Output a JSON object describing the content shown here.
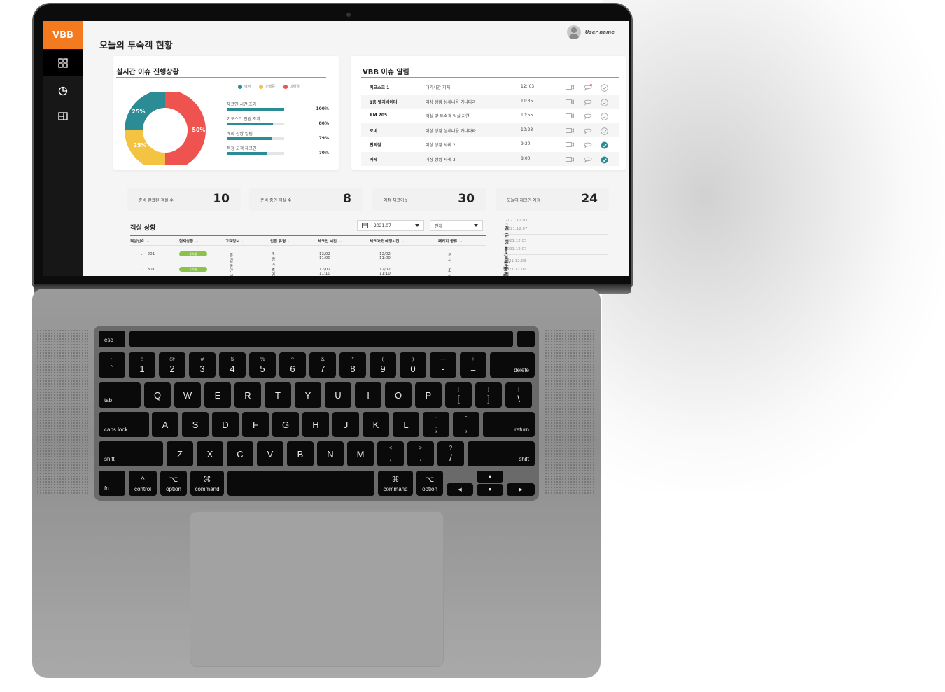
{
  "app": {
    "logo": "VBB",
    "page_title": "오늘의 투숙객 현황",
    "user_name": "User name",
    "sidebar": [
      {
        "icon": "grid-icon"
      },
      {
        "icon": "pie-chart-icon"
      },
      {
        "icon": "room-layout-icon"
      }
    ]
  },
  "progress_card": {
    "title": "실시간 이슈 진행상황",
    "legend": [
      {
        "label": "예정",
        "color": "#2b8c96"
      },
      {
        "label": "진행중",
        "color": "#f5c342"
      },
      {
        "label": "미해결",
        "color": "#ef5350"
      }
    ],
    "donut": [
      {
        "label": "50%",
        "value": 50,
        "color": "#ef5350"
      },
      {
        "label": "25%",
        "value": 25,
        "color": "#f5c342"
      },
      {
        "label": "25%",
        "value": 25,
        "color": "#2b8c96"
      }
    ],
    "bars": [
      {
        "label": "체크인 시간 초과",
        "pct": "100%",
        "value": 1.0
      },
      {
        "label": "키오스크 인원 초과",
        "pct": "80%",
        "value": 0.8
      },
      {
        "label": "배회 상황 알림",
        "pct": "79%",
        "value": 0.79
      },
      {
        "label": "특정 고객 체크인",
        "pct": "70%",
        "value": 0.7
      }
    ]
  },
  "alert_card": {
    "title": "VBB 이슈 알림",
    "rows": [
      {
        "location": "키오스크 1",
        "desc": "대기시간 지체",
        "time": "12: 03",
        "resolved": false,
        "new_message": true
      },
      {
        "location": "1층 엘리베이터",
        "desc": "이상 상황 상세내용 가나다라",
        "time": "11:35",
        "resolved": false,
        "new_message": false
      },
      {
        "location": "RM 205",
        "desc": "객실 앞 투숙객 입실 지연",
        "time": "10:55",
        "resolved": false,
        "new_message": false
      },
      {
        "location": "로비",
        "desc": "이상 상황 상세내용 가나다라",
        "time": "10:23",
        "resolved": false,
        "new_message": false
      },
      {
        "location": "편의점",
        "desc": "이상 상황 사례 2",
        "time": "9:20",
        "resolved": true,
        "new_message": false
      },
      {
        "location": "카페",
        "desc": "이상 상황 사례 3",
        "time": "8:00",
        "resolved": true,
        "new_message": false
      }
    ]
  },
  "stats": [
    {
      "label": "준비 완료된 객실 수",
      "value": "10"
    },
    {
      "label": "준비 중인 객실 수",
      "value": "8"
    },
    {
      "label": "예정 체크아웃",
      "value": "30"
    },
    {
      "label": "오늘의 체크인 예정",
      "value": "24"
    }
  ],
  "room_status": {
    "title": "객실 상황",
    "date_filter": "2021.07",
    "type_filter": "전체",
    "columns": [
      "객실번호",
      "현재상황",
      "고객정보",
      "인원 유형",
      "체크인 시간",
      "체크아웃 예정시간",
      "패키지 종류"
    ],
    "rows": [
      {
        "room": "201",
        "status": "투숙중",
        "guest": "홍길동",
        "people": "4명 가족",
        "checkin": "12/02  11:00",
        "checkout": "12/02  11:00",
        "package": "조식"
      },
      {
        "room": "301",
        "status": "투숙중",
        "guest": "안혜진",
        "people": "2명 연인",
        "checkin": "12/02  11:10",
        "checkout": "12/02  11:10",
        "package": "조식"
      }
    ]
  },
  "checkin_list": [
    {
      "dates": "2021.12.03 ~ 2021.12.07",
      "name": "김춘영 + 3인, 조식 패키지"
    },
    {
      "dates": "2021.12.03 ~ 2021.12.07",
      "name": "홍길동 + 2인, 허니문패키지"
    },
    {
      "dates": "2021.12.03 ~ 2021.12.07",
      "name": "정민수 + 2인, 상패연"
    }
  ],
  "keyboard": {
    "esc": "esc",
    "number_row": [
      {
        "top": "~",
        "main": "`"
      },
      {
        "top": "!",
        "main": "1"
      },
      {
        "top": "@",
        "main": "2"
      },
      {
        "top": "#",
        "main": "3"
      },
      {
        "top": "$",
        "main": "4"
      },
      {
        "top": "%",
        "main": "5"
      },
      {
        "top": "^",
        "main": "6"
      },
      {
        "top": "&",
        "main": "7"
      },
      {
        "top": "*",
        "main": "8"
      },
      {
        "top": "(",
        "main": "9"
      },
      {
        "top": ")",
        "main": "0"
      },
      {
        "top": "—",
        "main": "-"
      },
      {
        "top": "+",
        "main": "="
      }
    ],
    "delete": "delete",
    "tab": "tab",
    "qwerty_row": [
      "Q",
      "W",
      "E",
      "R",
      "T",
      "Y",
      "U",
      "I",
      "O",
      "P"
    ],
    "qwerty_tail": [
      {
        "top": "{",
        "main": "["
      },
      {
        "top": "}",
        "main": "]"
      },
      {
        "top": "|",
        "main": "\\"
      }
    ],
    "caps": "caps lock",
    "home_row": [
      "A",
      "S",
      "D",
      "F",
      "G",
      "H",
      "J",
      "K",
      "L"
    ],
    "home_tail": [
      {
        "top": ":",
        "main": ";"
      },
      {
        "top": "\"",
        "main": ","
      }
    ],
    "return": "return",
    "shift": "shift",
    "bottom_row": [
      "Z",
      "X",
      "C",
      "V",
      "B",
      "N",
      "M"
    ],
    "bottom_tail": [
      {
        "top": "<",
        "main": ","
      },
      {
        "top": ">",
        "main": "."
      },
      {
        "top": "?",
        "main": "/"
      }
    ],
    "fn": "fn",
    "control": {
      "top": "^",
      "main": "control"
    },
    "option": {
      "top": "⌥",
      "main": "option"
    },
    "command": {
      "top": "⌘",
      "main": "command"
    },
    "arrows": {
      "left": "◀",
      "up": "▲",
      "down": "▼",
      "right": "▶"
    }
  }
}
